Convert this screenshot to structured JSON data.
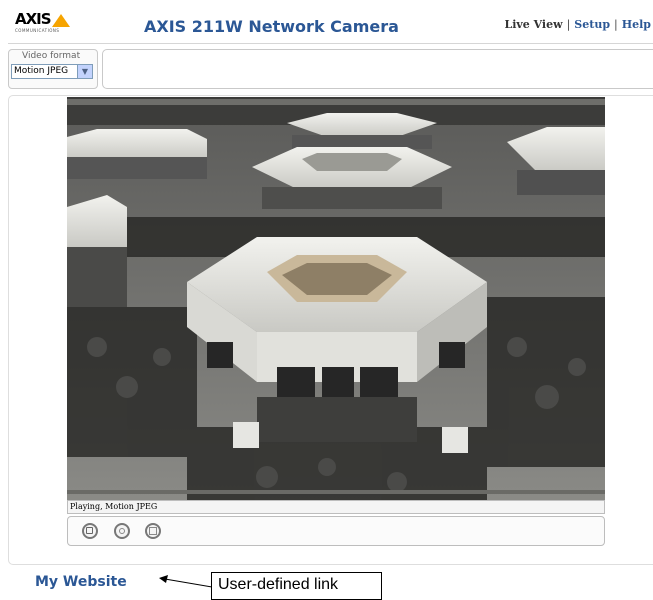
{
  "header": {
    "logo_text": "AXIS",
    "logo_sub": "COMMUNICATIONS",
    "title": "AXIS 211W Network Camera",
    "nav": [
      {
        "label": "Live View"
      },
      {
        "label": "Setup"
      },
      {
        "label": "Help"
      }
    ],
    "nav_separator": "|"
  },
  "format_bar": {
    "label": "Video format",
    "selected": "Motion JPEG",
    "arrow_glyph": "▼"
  },
  "viewer": {
    "status_text": "Playing, Motion JPEG",
    "controls": [
      {
        "name": "stop",
        "icon": "stop-icon"
      },
      {
        "name": "snapshot",
        "icon": "snapshot-icon"
      },
      {
        "name": "fullscreen",
        "icon": "fullscreen-icon"
      }
    ]
  },
  "footer": {
    "link_label": "My Website",
    "callout_text": "User-defined link"
  },
  "colors": {
    "brand_blue": "#2b5795",
    "logo_orange": "#f6a400"
  }
}
